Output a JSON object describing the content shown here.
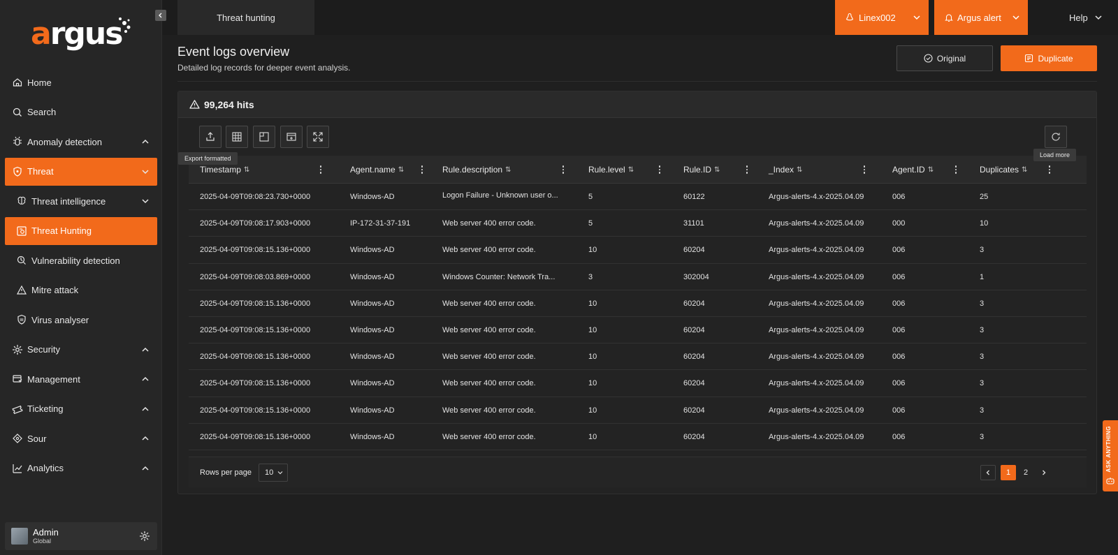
{
  "brand": {
    "logo": "argus",
    "accent": "#f26a1b"
  },
  "sidebar": {
    "items": [
      {
        "label": "Home",
        "icon": "home-icon"
      },
      {
        "label": "Search",
        "icon": "search-icon"
      },
      {
        "label": "Anomaly detection",
        "icon": "bug-icon",
        "chevron": "up"
      },
      {
        "label": "Threat",
        "icon": "shield-icon",
        "chevron": "down",
        "active": true
      },
      {
        "label": "Threat intelligence",
        "icon": "brain-icon",
        "chevron": "down"
      },
      {
        "label": "Threat Hunting",
        "icon": "hunt-icon",
        "active": true
      },
      {
        "label": "Vulnerability detection",
        "icon": "scan-icon"
      },
      {
        "label": "Mitre attack",
        "icon": "mitre-icon"
      },
      {
        "label": "Virus analyser",
        "icon": "virus-shield-icon"
      },
      {
        "label": "Security",
        "icon": "gear-icon",
        "chevron": "up"
      },
      {
        "label": "Management",
        "icon": "management-icon",
        "chevron": "up"
      },
      {
        "label": "Ticketing",
        "icon": "ticket-icon",
        "chevron": "up"
      },
      {
        "label": "Sour",
        "icon": "diamond-icon",
        "chevron": "up"
      },
      {
        "label": "Analytics",
        "icon": "analytics-icon",
        "chevron": "up"
      }
    ],
    "user": {
      "name": "Admin",
      "role": "Global"
    }
  },
  "header": {
    "tab": "Threat hunting",
    "agent": "Linex002",
    "alerts": "Argus alert",
    "help": "Help"
  },
  "main": {
    "title": "Event logs overview",
    "subtitle": "Detailed log records for deeper event analysis.",
    "original_label": "Original",
    "duplicate_label": "Duplicate",
    "hits": "99,264 hits",
    "tooltip_export": "Export formatted",
    "tooltip_load": "Load more"
  },
  "table": {
    "columns": [
      "Timestamp",
      "Agent.name",
      "Rule.description",
      "Rule.level",
      "Rule.ID",
      "_Index",
      "Agent.ID",
      "Duplicates"
    ],
    "rows": [
      [
        "2025-04-09T09:08:23.730+0000",
        "Windows-AD",
        "Logon Failure - Unknown user o...",
        "5",
        "60122",
        "Argus-alerts-4.x-2025.04.09",
        "006",
        "25"
      ],
      [
        "2025-04-09T09:08:17.903+0000",
        "IP-172-31-37-191",
        "Web server 400 error code.",
        "5",
        "31101",
        "Argus-alerts-4.x-2025.04.09",
        "000",
        "10"
      ],
      [
        "2025-04-09T09:08:15.136+0000",
        "Windows-AD",
        "Web server 400 error code.",
        "10",
        "60204",
        "Argus-alerts-4.x-2025.04.09",
        "006",
        "3"
      ],
      [
        "2025-04-09T09:08:03.869+0000",
        "Windows-AD",
        "Windows Counter: Network Tra...",
        "3",
        "302004",
        "Argus-alerts-4.x-2025.04.09",
        "006",
        "1"
      ],
      [
        "2025-04-09T09:08:15.136+0000",
        "Windows-AD",
        "Web server 400 error code.",
        "10",
        "60204",
        "Argus-alerts-4.x-2025.04.09",
        "006",
        "3"
      ],
      [
        "2025-04-09T09:08:15.136+0000",
        "Windows-AD",
        "Web server 400 error code.",
        "10",
        "60204",
        "Argus-alerts-4.x-2025.04.09",
        "006",
        "3"
      ],
      [
        "2025-04-09T09:08:15.136+0000",
        "Windows-AD",
        "Web server 400 error code.",
        "10",
        "60204",
        "Argus-alerts-4.x-2025.04.09",
        "006",
        "3"
      ],
      [
        "2025-04-09T09:08:15.136+0000",
        "Windows-AD",
        "Web server 400 error code.",
        "10",
        "60204",
        "Argus-alerts-4.x-2025.04.09",
        "006",
        "3"
      ],
      [
        "2025-04-09T09:08:15.136+0000",
        "Windows-AD",
        "Web server 400 error code.",
        "10",
        "60204",
        "Argus-alerts-4.x-2025.04.09",
        "006",
        "3"
      ],
      [
        "2025-04-09T09:08:15.136+0000",
        "Windows-AD",
        "Web server 400 error code.",
        "10",
        "60204",
        "Argus-alerts-4.x-2025.04.09",
        "006",
        "3"
      ]
    ]
  },
  "pagination": {
    "rows_per_page_label": "Rows per page",
    "rows_per_page": "10",
    "pages": [
      "1",
      "2"
    ],
    "current": "1"
  },
  "ask_anything": "ASK ANYTHING"
}
